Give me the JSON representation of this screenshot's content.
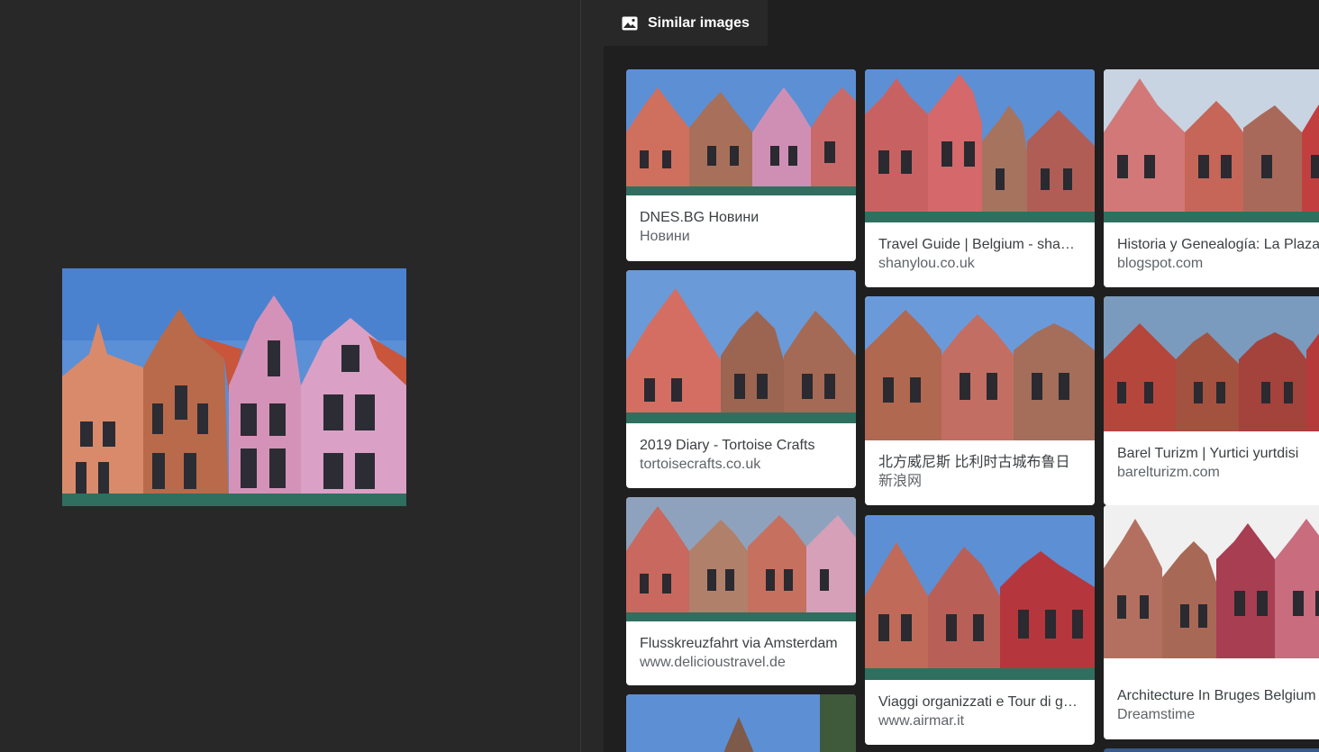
{
  "similar_tab": {
    "label": "Similar images",
    "icon": "image-icon"
  },
  "colors": {
    "background": "#282828",
    "panel": "#1f1f1f",
    "card": "#ffffff",
    "title_text": "#3c4043",
    "source_text": "#5f6368"
  },
  "results": [
    {
      "title": "DNES.BG Новини",
      "source": "Новини"
    },
    {
      "title": "2019 Diary - Tortoise Crafts",
      "source": "tortoisecrafts.co.uk"
    },
    {
      "title": "Flusskreuzfahrt via Amsterdam",
      "source": "www.delicioustravel.de"
    },
    {
      "title": "Travel Guide | Belgium - shanylou",
      "source": "shanylou.co.uk"
    },
    {
      "title": "北方威尼斯 比利时古城布鲁日",
      "source": "新浪网"
    },
    {
      "title": "Viaggi organizzati e Tour di gruppo",
      "source": "www.airmar.it"
    },
    {
      "title": "Historia y Genealogía: La Plaza",
      "source": "blogspot.com"
    },
    {
      "title": "Barel Turizm | Yurtici yurtdisi",
      "source": "barelturizm.com"
    },
    {
      "title": "Architecture In Bruges Belgium",
      "source": "Dreamstime"
    }
  ]
}
